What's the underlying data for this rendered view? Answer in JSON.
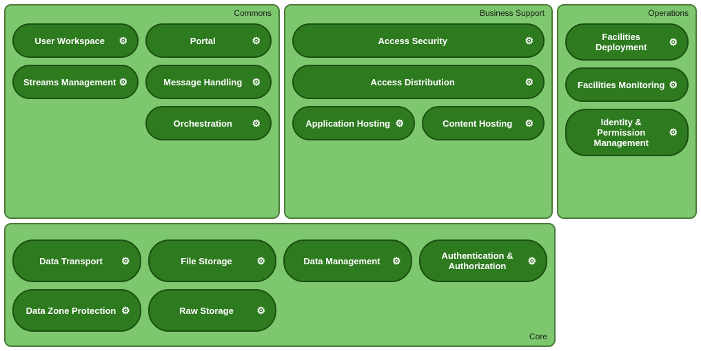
{
  "sections": {
    "commons": {
      "label": "Commons",
      "chips": [
        {
          "id": "user-workspace",
          "text": "User Workspace",
          "icon": "⚙"
        },
        {
          "id": "portal",
          "text": "Portal",
          "icon": "⚙"
        },
        {
          "id": "streams-management",
          "text": "Streams Management",
          "icon": "⚙"
        },
        {
          "id": "message-handling",
          "text": "Message Handling",
          "icon": "⚙"
        },
        {
          "id": "orchestration",
          "text": "Orchestration",
          "icon": "⚙"
        }
      ]
    },
    "business_support": {
      "label": "Business Support",
      "chips": [
        {
          "id": "access-security",
          "text": "Access Security",
          "icon": "⚙"
        },
        {
          "id": "access-distribution",
          "text": "Access Distribution",
          "icon": "⚙"
        },
        {
          "id": "application-hosting",
          "text": "Application Hosting",
          "icon": "⚙"
        },
        {
          "id": "content-hosting",
          "text": "Content Hosting",
          "icon": "⚙"
        }
      ]
    },
    "operations": {
      "label": "Operations",
      "chips": [
        {
          "id": "facilities-deployment",
          "text": "Facilities Deployment",
          "icon": "⚙"
        },
        {
          "id": "facilities-monitoring",
          "text": "Facilities Monitoring",
          "icon": "⚙"
        },
        {
          "id": "identity-permission-management",
          "text": "Identity & Permission Management",
          "icon": "⚙"
        }
      ]
    },
    "core": {
      "label": "Core",
      "chips": [
        {
          "id": "data-transport",
          "text": "Data Transport",
          "icon": "⚙"
        },
        {
          "id": "file-storage",
          "text": "File Storage",
          "icon": "⚙"
        },
        {
          "id": "data-management",
          "text": "Data Management",
          "icon": "⚙"
        },
        {
          "id": "authentication-authorization",
          "text": "Authentication & Authorization",
          "icon": "⚙"
        },
        {
          "id": "data-zone-protection",
          "text": "Data Zone Protection",
          "icon": "⚙"
        },
        {
          "id": "raw-storage",
          "text": "Raw Storage",
          "icon": "⚙"
        }
      ]
    }
  }
}
